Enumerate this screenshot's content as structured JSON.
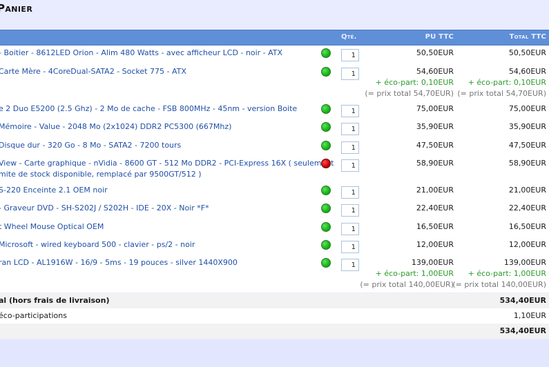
{
  "page": {
    "title": "Panier"
  },
  "header": {
    "qte": "Qté.",
    "pu": "PU TTC",
    "total": "Total TTC"
  },
  "items": [
    {
      "name": "- Boitier - 8612LED Orion - Alim 480 Watts - avec afficheur LCD - noir - ATX",
      "qty": "1",
      "pu": "50,50EUR",
      "total": "50,50EUR",
      "stock": "green"
    },
    {
      "name": "Carte Mère - 4CoreDual-SATA2 - Socket 775 - ATX",
      "qty": "1",
      "pu": "54,60EUR",
      "total": "54,60EUR",
      "eco": "+ éco-part: 0,10EUR",
      "prix_total": "(= prix total 54,70EUR)",
      "stock": "green"
    },
    {
      "name": "e 2 Duo E5200 (2.5 Ghz) - 2 Mo de cache - FSB 800MHz - 45nm - version Boite",
      "qty": "1",
      "pu": "75,00EUR",
      "total": "75,00EUR",
      "stock": "green"
    },
    {
      "name": "Mémoire - Value - 2048 Mo (2x1024) DDR2 PC5300 (667Mhz)",
      "qty": "1",
      "pu": "35,90EUR",
      "total": "35,90EUR",
      "stock": "green"
    },
    {
      "name": "Disque dur - 320 Go - 8 Mo - SATA2 - 7200 tours",
      "qty": "1",
      "pu": "47,50EUR",
      "total": "47,50EUR",
      "stock": "green"
    },
    {
      "name": "View - Carte graphique - nVidia - 8600 GT - 512 Mo DDR2 - PCI-Express 16X ( seulement",
      "name2": "mite de stock disponible, remplacé par 9500GT/512 )",
      "qty": "1",
      "pu": "58,90EUR",
      "total": "58,90EUR",
      "stock": "red"
    },
    {
      "name": "S-220 Enceinte 2.1 OEM noir",
      "qty": "1",
      "pu": "21,00EUR",
      "total": "21,00EUR",
      "stock": "green"
    },
    {
      "name": "- Graveur DVD - SH-S202J / S202H - IDE - 20X - Noir *F*",
      "qty": "1",
      "pu": "22,40EUR",
      "total": "22,40EUR",
      "stock": "green"
    },
    {
      "name": "t Wheel Mouse Optical OEM",
      "qty": "1",
      "pu": "16,50EUR",
      "total": "16,50EUR",
      "stock": "green"
    },
    {
      "name": "Microsoft - wired keyboard 500 - clavier - ps/2 - noir",
      "qty": "1",
      "pu": "12,00EUR",
      "total": "12,00EUR",
      "stock": "green"
    },
    {
      "name": "ran LCD - AL1916W - 16/9 - 5ms - 19 pouces - silver 1440X900",
      "qty": "1",
      "pu": "139,00EUR",
      "total": "139,00EUR",
      "eco": "+ éco-part: 1,00EUR",
      "prix_total": "(= prix total 140,00EUR)",
      "stock": "green"
    }
  ],
  "summary": {
    "subtotal_label": "al (hors frais de livraison)",
    "subtotal_value": "534,40EUR",
    "eco_label": "éco-participations",
    "eco_value": "1,10EUR",
    "total_value": "534,40EUR"
  },
  "colors": {
    "header": "#5f8fd7",
    "link": "#1f4fa6",
    "eco": "#2a9a2a",
    "stock_ok": "#18b818",
    "stock_ko": "#c80000"
  }
}
